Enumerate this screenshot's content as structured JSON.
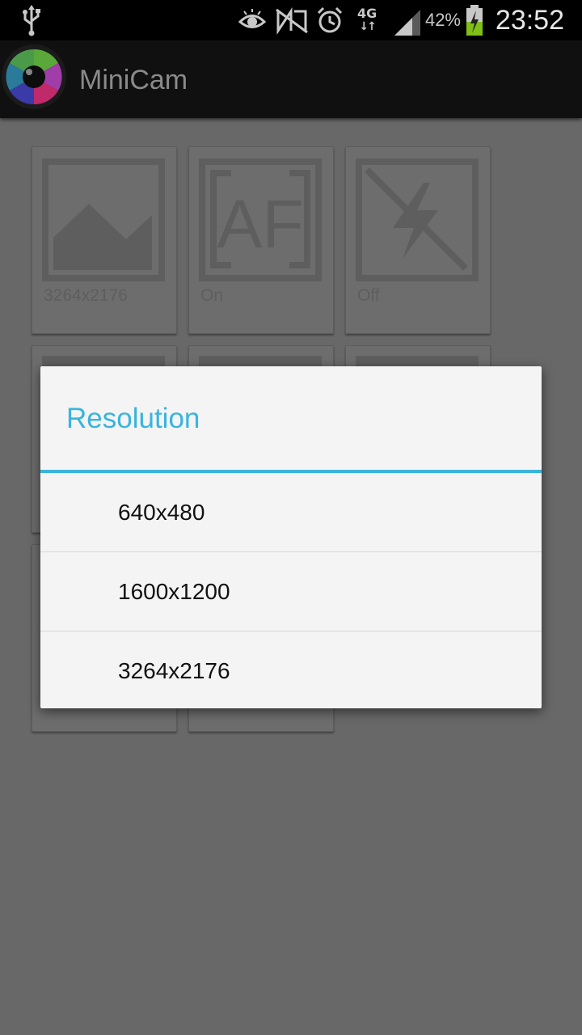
{
  "status_bar": {
    "battery_percent": "42%",
    "network": "4G",
    "time": "23:52"
  },
  "action_bar": {
    "title": "MiniCam"
  },
  "tiles": [
    {
      "label": "3264x2176",
      "icon": "image-icon"
    },
    {
      "label": "On",
      "icon": "autofocus-icon"
    },
    {
      "label": "Off",
      "icon": "flash-off-icon"
    }
  ],
  "dialog": {
    "title": "Resolution",
    "options": [
      "640x480",
      "1600x1200",
      "3264x2176"
    ],
    "accent_color": "#3ab4dd"
  }
}
